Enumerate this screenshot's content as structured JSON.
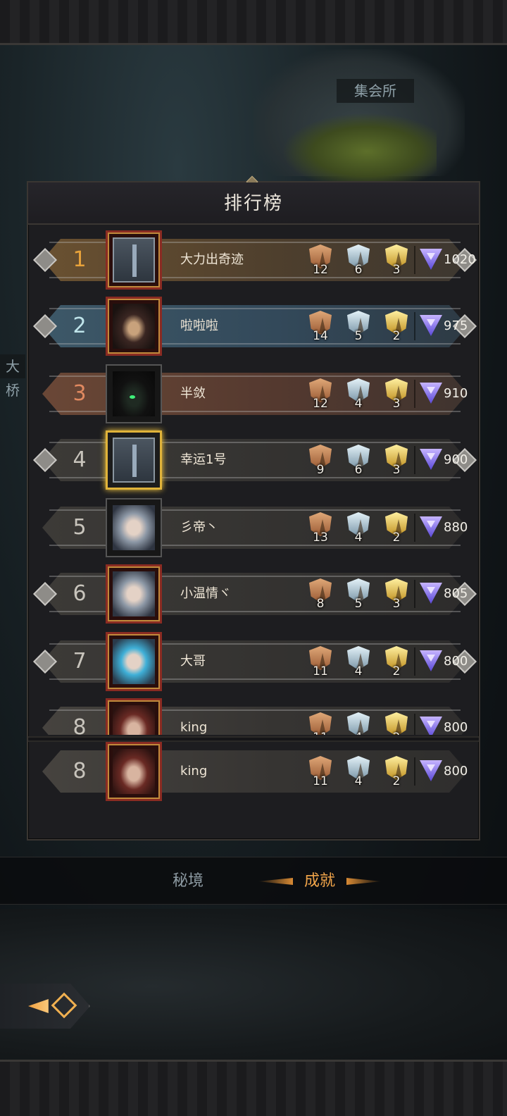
{
  "scene": {
    "place_label": "集会所",
    "side_label": "大桥"
  },
  "panel": {
    "title": "排行榜"
  },
  "leaderboard": [
    {
      "rank": "1",
      "name": "大力出奇迹",
      "bronze": "12",
      "silver": "6",
      "gold": "3",
      "score": "1020",
      "style": "gold",
      "avatar": "book"
    },
    {
      "rank": "2",
      "name": "啦啦啦",
      "bronze": "14",
      "silver": "5",
      "gold": "2",
      "score": "975",
      "style": "blue",
      "avatar": "hood"
    },
    {
      "rank": "3",
      "name": "半敛",
      "bronze": "12",
      "silver": "4",
      "gold": "3",
      "score": "910",
      "style": "bronze",
      "avatar": "dark"
    },
    {
      "rank": "4",
      "name": "幸运1号",
      "bronze": "9",
      "silver": "6",
      "gold": "3",
      "score": "900",
      "style": "plain",
      "avatar": "book"
    },
    {
      "rank": "5",
      "name": "彡帝丶",
      "bronze": "13",
      "silver": "4",
      "gold": "2",
      "score": "880",
      "style": "plain",
      "avatar": "face"
    },
    {
      "rank": "6",
      "name": "小温情ヾ",
      "bronze": "8",
      "silver": "5",
      "gold": "3",
      "score": "805",
      "style": "plain",
      "avatar": "face"
    },
    {
      "rank": "7",
      "name": "大哥",
      "bronze": "11",
      "silver": "4",
      "gold": "2",
      "score": "800",
      "style": "plain",
      "avatar": "face-blue"
    },
    {
      "rank": "8",
      "name": "king",
      "bronze": "11",
      "silver": "4",
      "gold": "2",
      "score": "800",
      "style": "grey",
      "avatar": "king"
    }
  ],
  "my_entry": {
    "rank": "8",
    "name": "king",
    "bronze": "11",
    "silver": "4",
    "gold": "2",
    "score": "800"
  },
  "tabs": {
    "secret": "秘境",
    "achievement": "成就"
  }
}
